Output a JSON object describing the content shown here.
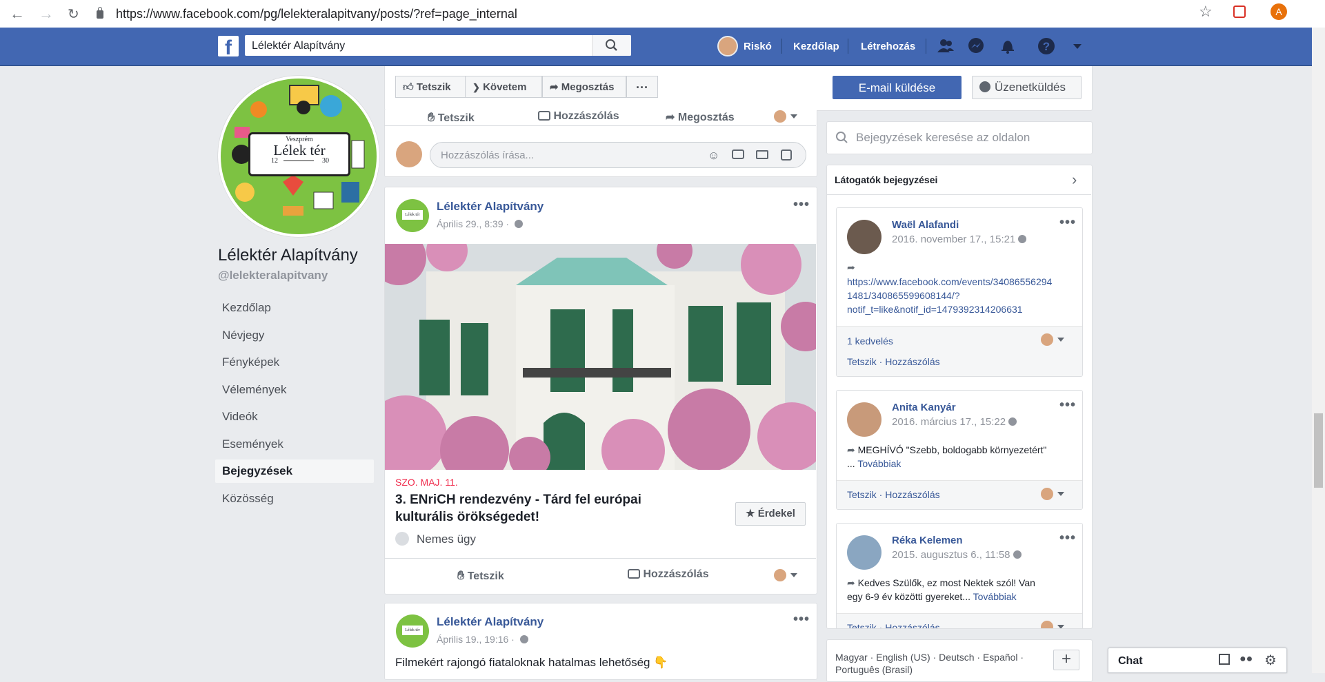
{
  "browser": {
    "url": "https://www.facebook.com/pg/lelekteralapitvany/posts/?ref=page_internal",
    "profile_initial": "A"
  },
  "topbar": {
    "search_value": "Lélektér Alapítvány",
    "user_name": "Riskó",
    "home": "Kezdőlap",
    "create": "Létrehozás"
  },
  "page": {
    "name": "Lélektér Alapítvány",
    "handle": "@lelekteralapitvany",
    "avatar_sign_top": "Veszprém",
    "avatar_sign_main": "Lélek tér",
    "avatar_sign_left": "12",
    "avatar_sign_right": "30",
    "avatar_small_label": "Lélek tér",
    "nav": [
      "Kezdőlap",
      "Névjegy",
      "Fényképek",
      "Vélemények",
      "Videók",
      "Események",
      "Bejegyzések",
      "Közösség"
    ]
  },
  "header_actions": {
    "like": "Tetszik",
    "follow": "Követem",
    "share": "Megosztás",
    "more": "···",
    "email": "E-mail küldése",
    "message": "Üzenetküldés"
  },
  "post0": {
    "like": "Tetszik",
    "comment": "Hozzászólás",
    "share": "Megosztás",
    "comment_placeholder": "Hozzászólás írása..."
  },
  "post1": {
    "author": "Lélektér Alapítvány",
    "time": "Április 29., 8:39 ·",
    "event_date": "SZO. MAJ. 11.",
    "event_title_1": "3. ENriCH rendezvény - Tárd fel európai",
    "event_title_2": "kulturális örökségedet!",
    "interested": "Érdekel",
    "cause": "Nemes ügy",
    "like": "Tetszik",
    "comment": "Hozzászólás"
  },
  "post2": {
    "author": "Lélektér Alapítvány",
    "time": "Április 19., 19:16 ·",
    "text": "Filmekért rajongó fiataloknak hatalmas lehetőség 👇"
  },
  "right": {
    "search_placeholder": "Bejegyzések keresése az oldalon",
    "visitors_title": "Látogatók bejegyzései",
    "visitors": [
      {
        "name": "Waël Alafandi",
        "time": "2016. november 17., 15:21",
        "text_1": "https://www.facebook.com/events/34086556294",
        "text_2": "1481/340865599608144/?",
        "text_3": "notif_t=like&notif_id=1479392314206631",
        "likes": "1 kedvelés",
        "like": "Tetszik",
        "comment": "Hozzászólás"
      },
      {
        "name": "Anita Kanyár",
        "time": "2016. március 17., 15:22",
        "text_1": "MEGHÍVÓ \"Szebb, boldogabb környezetért\"",
        "text_2": "...",
        "more": "Továbbiak",
        "like": "Tetszik",
        "comment": "Hozzászólás"
      },
      {
        "name": "Réka Kelemen",
        "time": "2015. augusztus 6., 11:58",
        "text_1": "Kedves Szülők, ez most Nektek szól! Van",
        "text_2": "egy 6-9 év közötti gyereket...",
        "more": "Továbbiak",
        "like": "Tetszik",
        "comment": "Hozzászólás"
      }
    ],
    "languages_1": "Magyar · English (US) · Deutsch · Español ·",
    "languages_2": "Português (Brasil)",
    "plus": "+"
  },
  "chat": {
    "label": "Chat"
  },
  "colors": {
    "fb_blue": "#4267b2",
    "link": "#385898",
    "event_red": "#f02849",
    "background": "#e9ebee"
  }
}
